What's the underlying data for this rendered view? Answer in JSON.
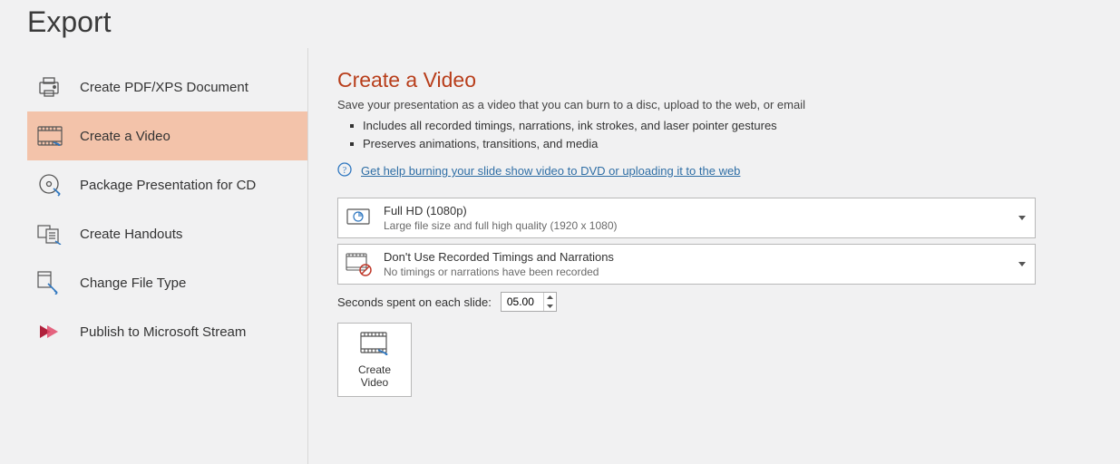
{
  "header": {
    "title": "Export"
  },
  "sidebar": {
    "items": [
      {
        "label": "Create PDF/XPS Document"
      },
      {
        "label": "Create a Video"
      },
      {
        "label": "Package Presentation for CD"
      },
      {
        "label": "Create Handouts"
      },
      {
        "label": "Change File Type"
      },
      {
        "label": "Publish to Microsoft Stream"
      }
    ],
    "selected_index": 1
  },
  "content": {
    "title": "Create a Video",
    "subtitle": "Save your presentation as a video that you can burn to a disc, upload to the web, or email",
    "bullets": [
      "Includes all recorded timings, narrations, ink strokes, and laser pointer gestures",
      "Preserves animations, transitions, and media"
    ],
    "help_link": "Get help burning your slide show video to DVD or uploading it to the web",
    "quality": {
      "title": "Full HD (1080p)",
      "sub": "Large file size and full high quality (1920 x 1080)"
    },
    "timings": {
      "title": "Don't Use Recorded Timings and Narrations",
      "sub": "No timings or narrations have been recorded"
    },
    "seconds_label": "Seconds spent on each slide:",
    "seconds_value": "05.00",
    "create_button": "Create\nVideo"
  }
}
